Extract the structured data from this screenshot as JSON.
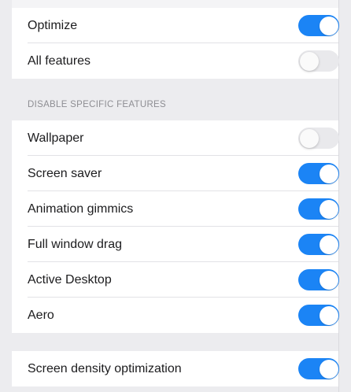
{
  "colors": {
    "toggle_on": "#1b84f5",
    "toggle_off": "#e9e9ec",
    "background": "#ececef",
    "section_header": "#8e8e93"
  },
  "group_main": {
    "rows": [
      {
        "label": "Optimize",
        "enabled": true
      },
      {
        "label": "All features",
        "enabled": false
      }
    ]
  },
  "section_header": "DISABLE SPECIFIC FEATURES",
  "group_features": {
    "rows": [
      {
        "label": "Wallpaper",
        "enabled": false
      },
      {
        "label": "Screen saver",
        "enabled": true
      },
      {
        "label": "Animation gimmics",
        "enabled": true
      },
      {
        "label": "Full window drag",
        "enabled": true
      },
      {
        "label": "Active Desktop",
        "enabled": true
      },
      {
        "label": "Aero",
        "enabled": true
      }
    ]
  },
  "group_density": {
    "rows": [
      {
        "label": "Screen density optimization",
        "enabled": true
      }
    ]
  }
}
